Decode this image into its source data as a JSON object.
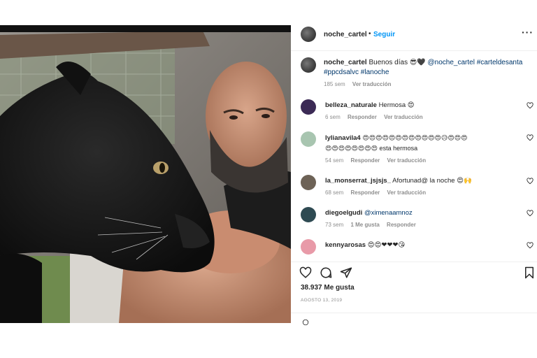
{
  "post": {
    "username": "noche_cartel",
    "separator": "•",
    "follow_label": "Seguir",
    "more_label": "···"
  },
  "caption": {
    "username": "noche_cartel",
    "text_prefix": "Buenos días 😎🖤",
    "mention": "@noche_cartel",
    "hashtags_line1": "#carteldesanta",
    "hashtags_line2": "#ppcdsalvc #lanoche",
    "age": "185 sem",
    "view_translation": "Ver traducción"
  },
  "comments": [
    {
      "username": "belleza_naturale",
      "text": "Hermosa 😍",
      "age": "6 sem",
      "reply_label": "Responder",
      "translate_label": "Ver traducción",
      "avatar_color": "#3b2a55"
    },
    {
      "username": "lylianavila4",
      "text": "😍😍😍😍😍😍😍😍😍😍😍😍😥😍😍😍",
      "text_line2": "😍😍😍😍😍😍😍😍 esta hermosa",
      "age": "54 sem",
      "reply_label": "Responder",
      "translate_label": "Ver traducción",
      "avatar_color": "#a8c5b0"
    },
    {
      "username": "la_monserrat_jsjsjs_",
      "text": "Afortunad@ la noche 😍🙌",
      "age": "68 sem",
      "reply_label": "Responder",
      "translate_label": "Ver traducción",
      "avatar_color": "#6d6256"
    },
    {
      "username": "diegoelgudi",
      "text": "@ximenaamnoz",
      "age": "73 sem",
      "likes_label": "1 Me gusta",
      "reply_label": "Responder",
      "avatar_color": "#2e4a52"
    },
    {
      "username": "kennyarosas",
      "text": "😍😍❤❤❤😘",
      "avatar_color": "#e89aa8"
    }
  ],
  "actions": {
    "like_icon": "heart-icon",
    "comment_icon": "comment-icon",
    "share_icon": "paper-plane-icon",
    "save_icon": "bookmark-icon"
  },
  "likes_count": "38.937 Me gusta",
  "date": "AGOSTO 13, 2019",
  "colors": {
    "link_blue": "#0095f6",
    "tag_blue": "#00376b",
    "muted": "#8e8e8e",
    "text": "#262626"
  }
}
